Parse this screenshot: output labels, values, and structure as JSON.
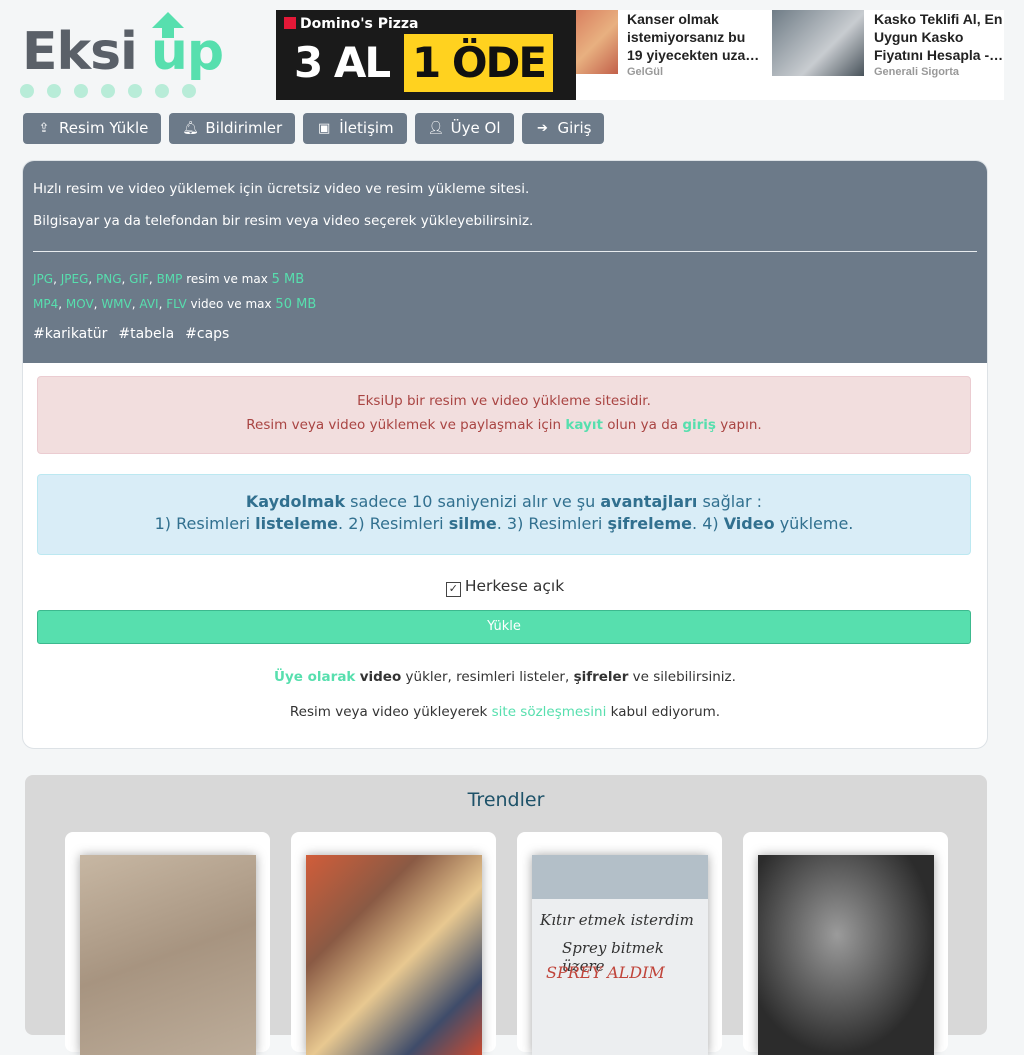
{
  "logo": {
    "part1": "Eksi",
    "part2": "up"
  },
  "ads": {
    "pizza_brand": "Domino's Pizza",
    "pizza_deal1": "3 AL",
    "pizza_deal2": "1 ÖDE",
    "item1_title": "Kanser olmak istemiyorsanız bu 19 yiyecekten uza…",
    "item1_source": "GelGül",
    "item2_title": "Kasko Teklifi Al, En Uygun Kasko Fiyatını Hesapla -…",
    "item2_source": "Generali Sigorta"
  },
  "nav": [
    {
      "label": "Resim Yükle",
      "icon": "upload-icon"
    },
    {
      "label": "Bildirimler",
      "icon": "bell-icon"
    },
    {
      "label": "İletişim",
      "icon": "contact-icon"
    },
    {
      "label": "Üye Ol",
      "icon": "user-plus-icon"
    },
    {
      "label": "Giriş",
      "icon": "sign-in-icon"
    }
  ],
  "intro": {
    "line1": "Hızlı resim ve video yüklemek için ücretsiz video ve resim yükleme sitesi.",
    "line2": "Bilgisayar ya da telefondan bir resim veya video seçerek yükleyebilirsiniz."
  },
  "formats": {
    "image_types": [
      "JPG",
      "JPEG",
      "PNG",
      "GIF",
      "BMP"
    ],
    "image_text": "resim ve max",
    "image_max": "5 MB",
    "video_types": [
      "MP4",
      "MOV",
      "WMV",
      "AVI",
      "FLV"
    ],
    "video_text": "video ve max",
    "video_max": "50 MB"
  },
  "tags": [
    "#karikatür",
    "#tabela",
    "#caps"
  ],
  "alert_red": {
    "line1": "EksiUp bir resim ve video yükleme sitesidir.",
    "line2_pre": "Resim veya video yüklemek ve paylaşmak için",
    "kayit": "kayıt",
    "line2_mid": "olun ya da",
    "giris": "giriş",
    "line2_post": "yapın."
  },
  "alert_blue": {
    "kaydolmak": "Kaydolmak",
    "t1": "sadece 10 saniyenizi alır ve şu",
    "avantajlari": "avantajları",
    "t2": "sağlar :",
    "p1": "1) Resimleri",
    "listeleme": "listeleme",
    "p2": ". 2) Resimleri",
    "silme": "silme",
    "p3": ". 3) Resimleri",
    "sifreleme": "şifreleme",
    "p4": ". 4)",
    "video": "Video",
    "p5": "yükleme."
  },
  "public_checkbox": {
    "label": "Herkese açık",
    "checked": true
  },
  "upload_button": "Yükle",
  "info": {
    "uye_olarak": "Üye olarak",
    "video": "video",
    "t1": "yükler, resimleri listeler,",
    "sifreler": "şifreler",
    "t2": "ve silebilirsiniz.",
    "agree_pre": "Resim veya video yükleyerek",
    "agree_link": "site sözleşmesini",
    "agree_post": "kabul ediyorum."
  },
  "trends": {
    "title": "Trendler",
    "graffiti": [
      "Kıtır etmek isterdim",
      "Sprey bitmek üzere",
      "SPREY ALDIM"
    ]
  },
  "colors": {
    "accent": "#57dfae",
    "nav": "#6c7a89",
    "title": "#1e5269"
  }
}
